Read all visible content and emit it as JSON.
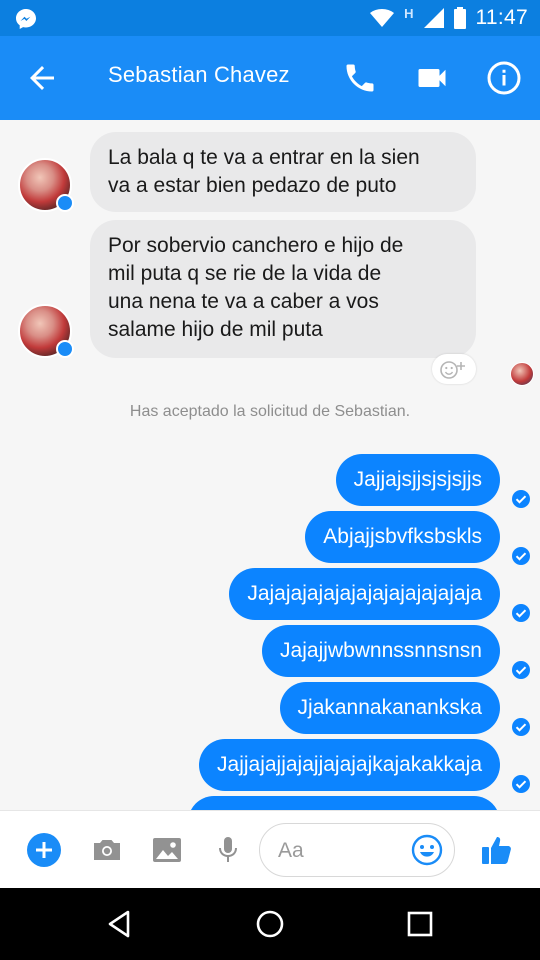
{
  "status_bar": {
    "time": "11:47",
    "network_label": "H"
  },
  "header": {
    "title": "Sebastian Chavez"
  },
  "messages_in": [
    {
      "lines": [
        "La bala q te va a entrar en la sien",
        "va a estar bien pedazo de puto"
      ]
    },
    {
      "lines": [
        "Por sobervio canchero e hijo de",
        "mil puta q se rie de la vida de",
        "una nena te va a caber a vos",
        "salame hijo de mil puta"
      ]
    }
  ],
  "system_note": "Has aceptado la solicitud de Sebastian.",
  "messages_out": [
    "Jajjajsjjsjsjsjjs",
    "Abjajjsbvfksbskls",
    "Jajajajajajajajajajajajajaja",
    "Jajajjwbwnnssnnsnsn",
    "Jjakannakanankska",
    "Jajjajajjajajjajajajkajakakkaja"
  ],
  "composer": {
    "placeholder": "Aa"
  },
  "colors": {
    "accent": "#1a8cf7",
    "status_bar": "#0c7fe0",
    "outgoing_bubble": "#0c84ff",
    "incoming_bubble": "#e9e9ea"
  },
  "icons": {
    "header": [
      "back-arrow-icon",
      "phone-icon",
      "video-camera-icon",
      "info-icon"
    ],
    "composer": [
      "plus-icon",
      "camera-icon",
      "image-icon",
      "microphone-icon",
      "emoji-icon",
      "thumbs-up-icon"
    ],
    "nav": [
      "back-triangle-icon",
      "home-circle-icon",
      "recents-square-icon"
    ]
  }
}
